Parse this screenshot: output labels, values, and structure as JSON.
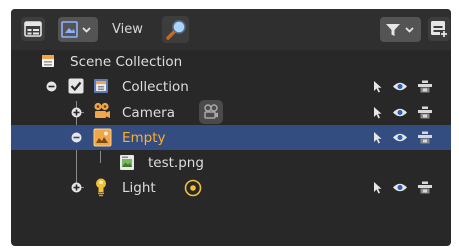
{
  "header": {
    "view_label": "View",
    "display_mode_icon": "outliner-display-mode-icon",
    "editor_type_icon": "outliner-editor-icon",
    "filter_icon": "funnel-icon",
    "new_collection_icon": "new-collection-icon"
  },
  "tree": {
    "scene_collection": {
      "label": "Scene Collection"
    },
    "collection": {
      "label": "Collection",
      "checked": true
    },
    "camera": {
      "label": "Camera"
    },
    "empty": {
      "label": "Empty"
    },
    "image": {
      "label": "test.png"
    },
    "light": {
      "label": "Light"
    }
  },
  "colors": {
    "panel_bg": "#282828",
    "header_bg": "#2f2f2f",
    "selection": "#334d80",
    "active_text": "#ffaf29",
    "text": "#dedede"
  }
}
